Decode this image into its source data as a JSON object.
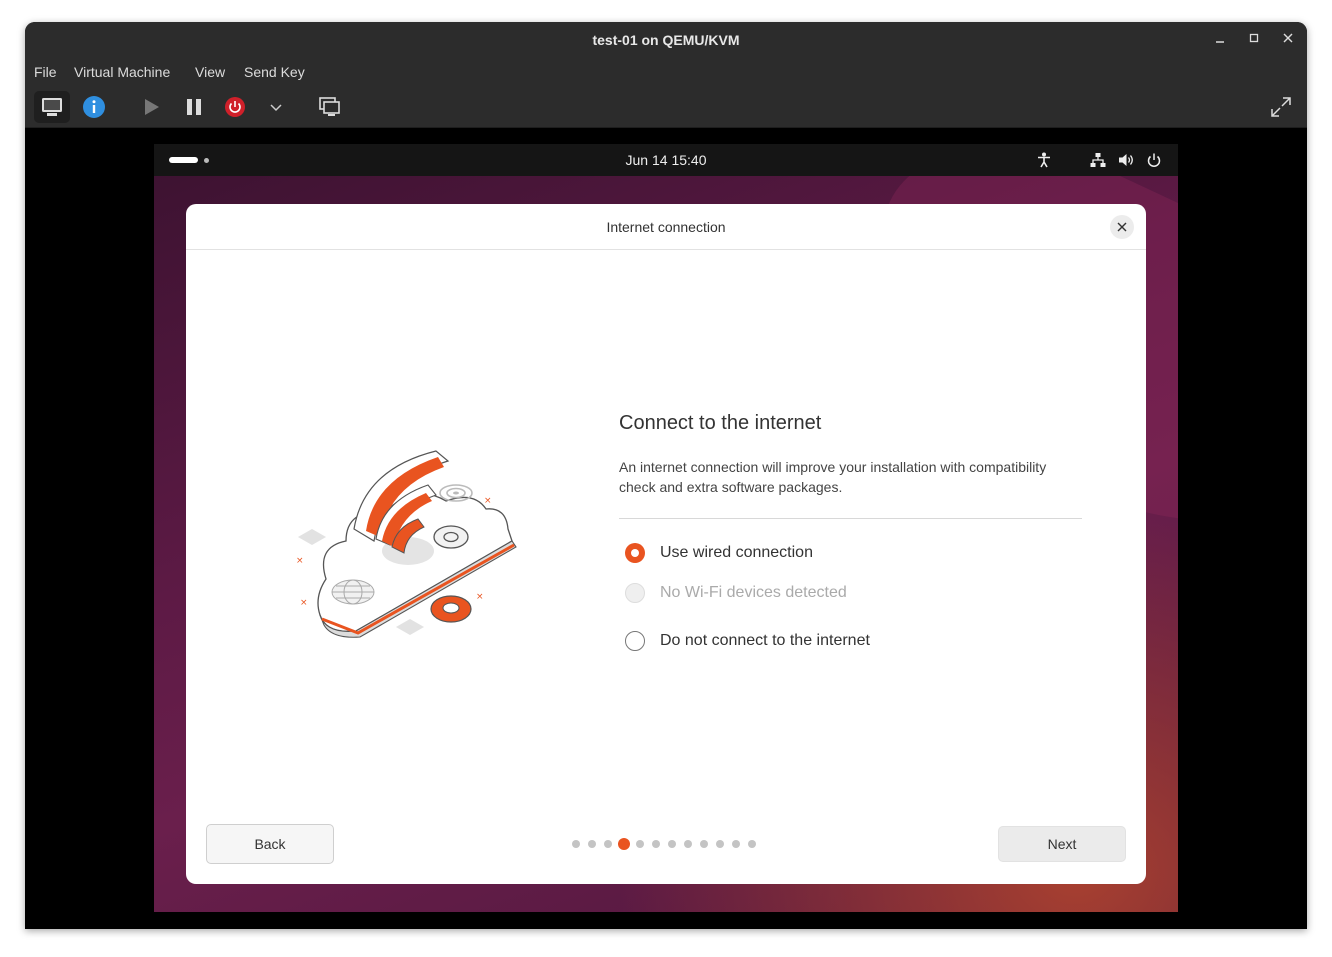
{
  "window": {
    "title": "test-01 on QEMU/KVM"
  },
  "menubar": {
    "items": [
      "File",
      "Virtual Machine",
      "View",
      "Send Key"
    ]
  },
  "guest": {
    "clock": "Jun 14  15:40",
    "dialog": {
      "title": "Internet connection",
      "heading": "Connect to the internet",
      "description": "An internet connection will improve your installation with compatibility check and extra software packages.",
      "options": [
        {
          "label": "Use wired connection",
          "selected": true,
          "disabled": false
        },
        {
          "label": "No Wi-Fi devices detected",
          "selected": false,
          "disabled": true
        },
        {
          "label": "Do not connect to the internet",
          "selected": false,
          "disabled": false
        }
      ],
      "back_label": "Back",
      "next_label": "Next",
      "steps_total": 12,
      "current_step": 4
    }
  },
  "colors": {
    "accent": "#e95420"
  }
}
